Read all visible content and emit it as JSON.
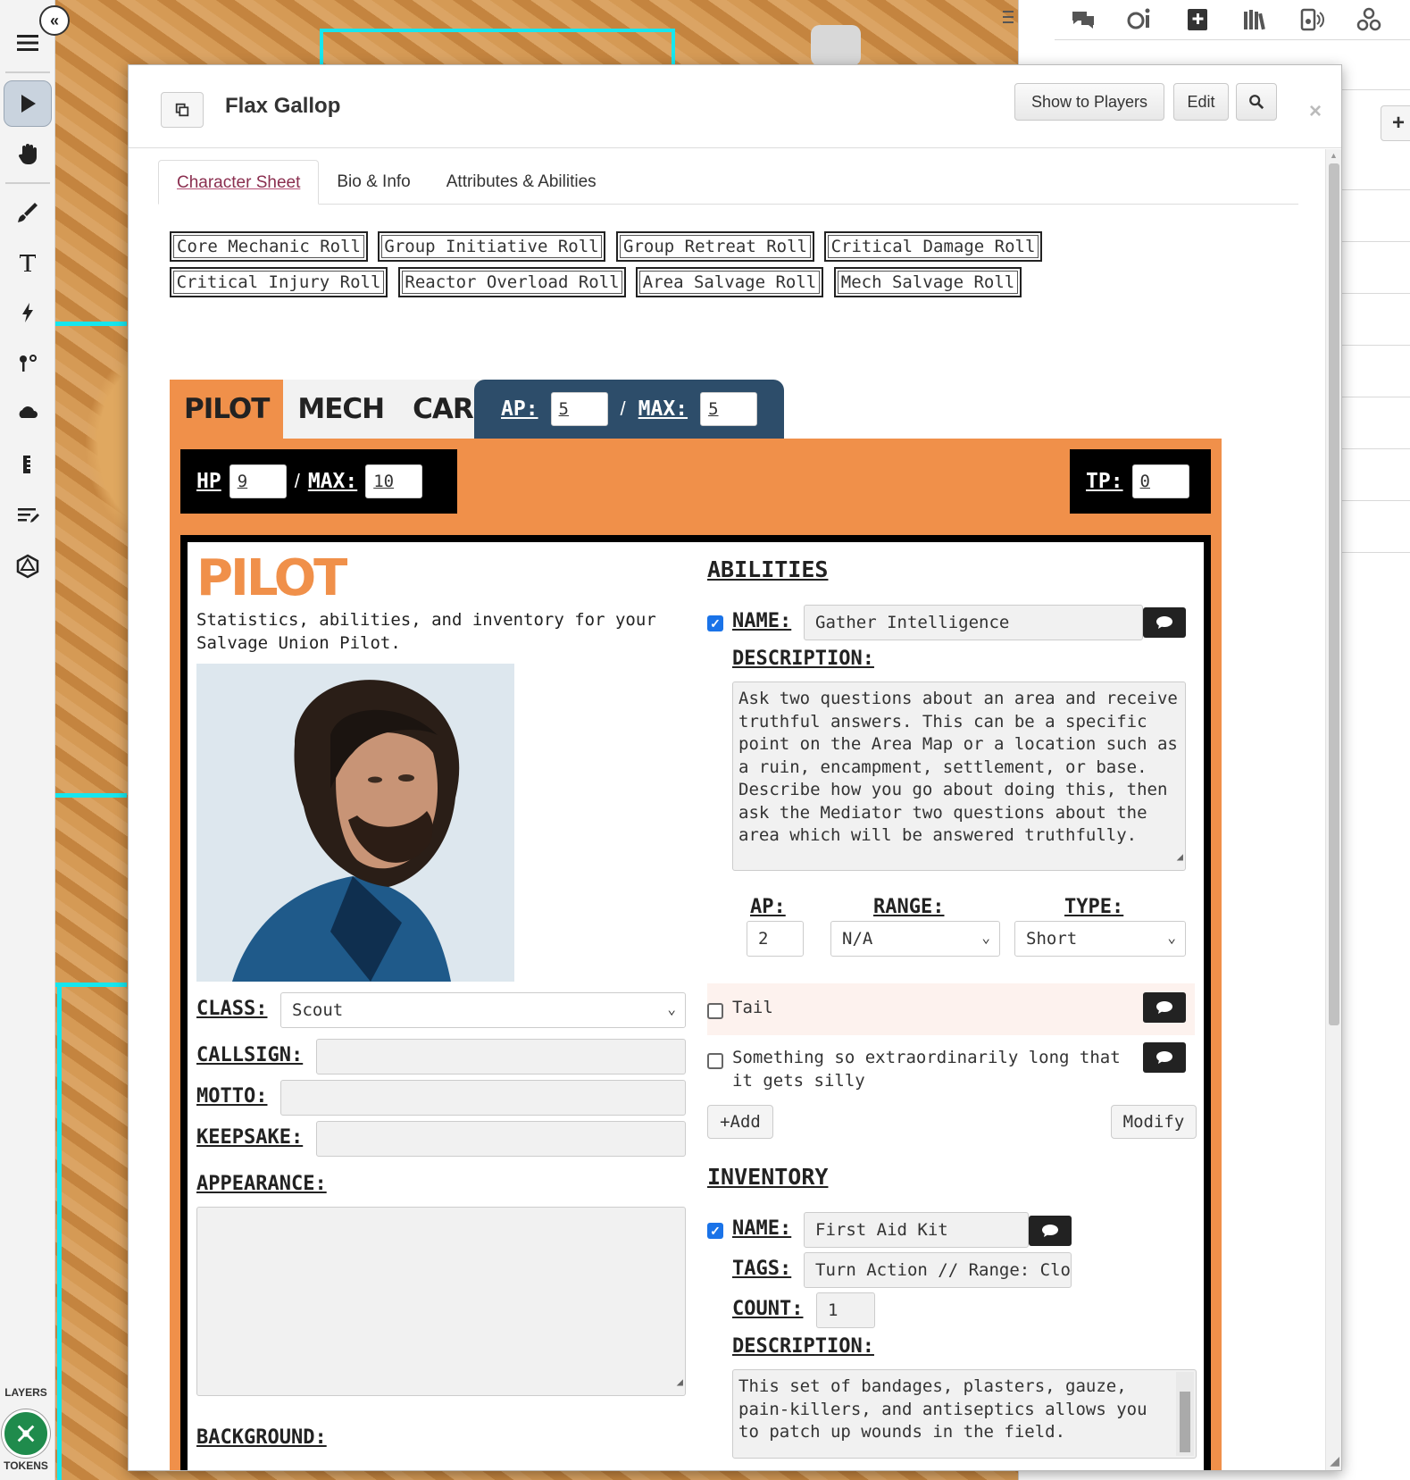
{
  "window": {
    "title": "Flax Gallop",
    "buttons": {
      "show_to_players": "Show to Players",
      "edit": "Edit"
    },
    "close_glyph": "×"
  },
  "tabs": [
    "Character Sheet",
    "Bio & Info",
    "Attributes & Abilities"
  ],
  "roll_buttons": [
    "Core Mechanic Roll",
    "Group Initiative Roll",
    "Group Retreat Roll",
    "Critical Damage Roll",
    "Critical Injury Roll",
    "Reactor Overload Roll",
    "Area Salvage Roll",
    "Mech Salvage Roll"
  ],
  "main_tabs": [
    "PILOT",
    "MECH",
    "CARGO"
  ],
  "ap": {
    "label": "AP:",
    "value": "5",
    "max_label": "MAX:",
    "max_value": "5",
    "sep": "/"
  },
  "hp": {
    "label": "HP",
    "value": "9",
    "max_label": "MAX:",
    "max_value": "10",
    "sep": "/"
  },
  "tp": {
    "label": "TP:",
    "value": "0"
  },
  "pilot": {
    "title": "PILOT",
    "description": "Statistics, abilities, and inventory for your Salvage Union Pilot.",
    "class_label": "CLASS:",
    "class_value": "Scout",
    "callsign_label": "CALLSIGN:",
    "callsign_value": "",
    "motto_label": "MOTTO:",
    "motto_value": "",
    "keepsake_label": "KEEPSAKE:",
    "keepsake_value": "",
    "appearance_label": "APPEARANCE:",
    "appearance_value": "",
    "background_label": "BACKGROUND:"
  },
  "abilities": {
    "heading": "ABILITIES",
    "name_label": "NAME:",
    "name_value": "Gather Intelligence",
    "description_label": "DESCRIPTION:",
    "description": "Ask two questions about an area and receive truthful answers. This can be a specific point on the Area Map or a location such as a ruin, encampment, settlement, or base. Describe how you go about doing this, then ask the Mediator two questions about the area which will be answered truthfully.",
    "ap_label": "AP:",
    "ap_value": "2",
    "range_label": "RANGE:",
    "range_value": "N/A",
    "type_label": "TYPE:",
    "type_value": "Short",
    "others": [
      "Tail",
      "Something so extraordinarily long that it gets silly"
    ],
    "add_label": "+Add",
    "modify_label": "Modify"
  },
  "inventory": {
    "heading": "INVENTORY",
    "name_label": "NAME:",
    "name_value": "First Aid Kit",
    "tags_label": "TAGS:",
    "tags_value": "Turn Action // Range: Clos",
    "count_label": "COUNT:",
    "count_value": "1",
    "description_label": "DESCRIPTION:",
    "description": "This set of bandages, plasters, gauze, pain-killers, and antiseptics allows you to patch up wounds in the field."
  },
  "left_toolbar": {
    "layers_label": "LAYERS",
    "tokens_label": "TOKENS",
    "tools": [
      "menu-icon",
      "select-icon",
      "pan-icon",
      "brush-icon",
      "text-icon",
      "lightning-icon",
      "fog-icon",
      "weather-icon",
      "ruler-icon",
      "notes-icon",
      "dice-icon"
    ]
  },
  "right_panel": {
    "icons": [
      "chat-icon",
      "roll-icon",
      "journal-icon",
      "library-icon",
      "audio-icon",
      "dice-tray-icon"
    ],
    "add_glyph": "+"
  },
  "colors": {
    "accent_orange": "#f0904a",
    "navy": "#2d4d6a",
    "cyan": "#16e6ee",
    "checkbox_blue": "#1a73e8"
  }
}
